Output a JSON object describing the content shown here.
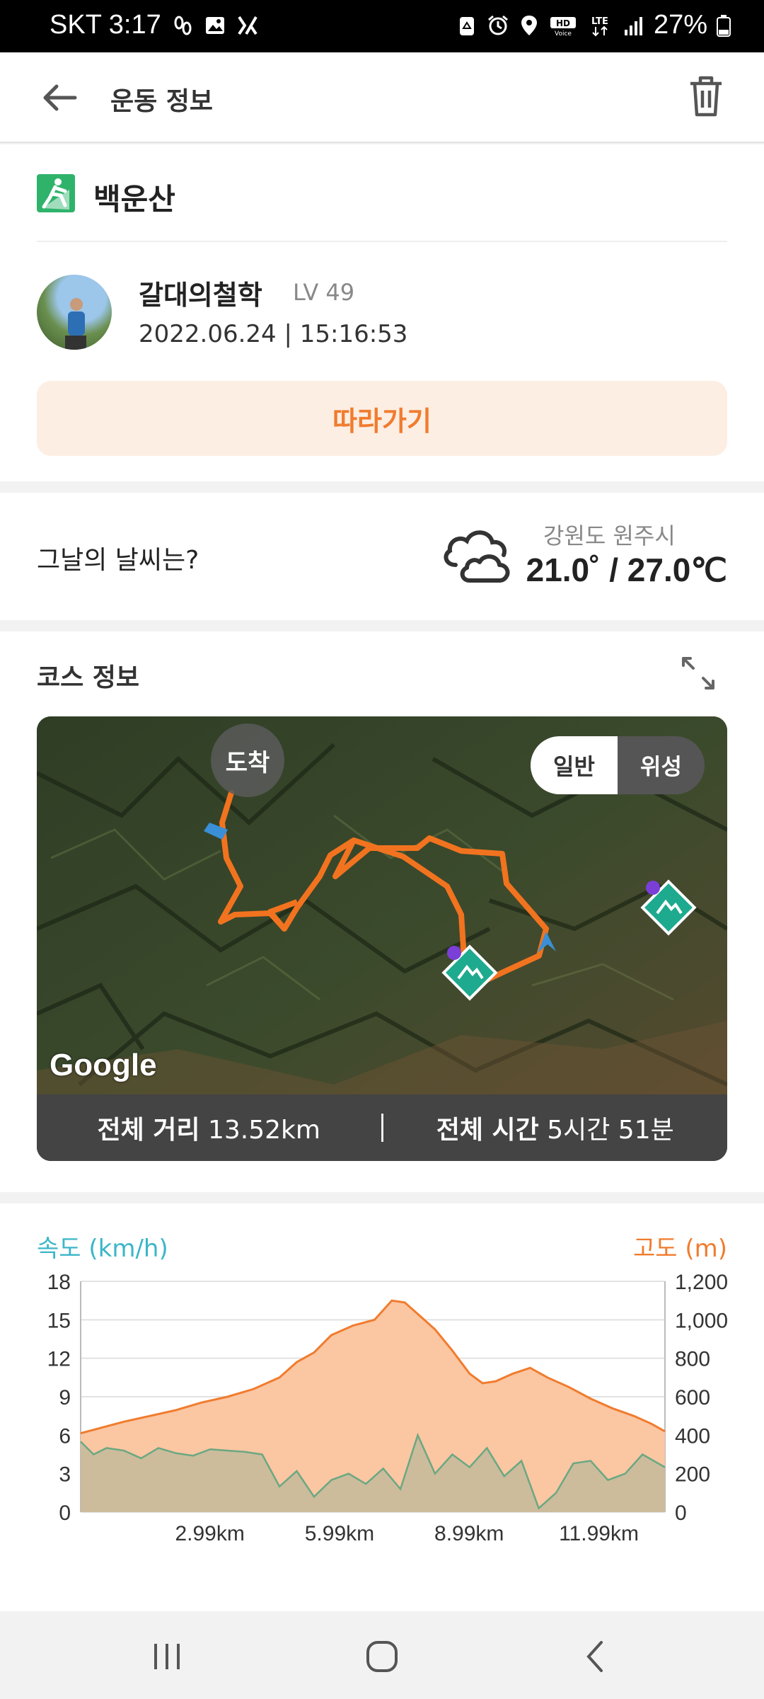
{
  "status_bar": {
    "carrier_time": "SKT 3:17",
    "battery_percent": "27%",
    "icons": [
      "steps-icon",
      "gallery-icon",
      "dev-icon",
      "recycle-icon",
      "alarm-icon",
      "location-icon",
      "hd-voice-icon",
      "lte-icon",
      "signal-icon",
      "battery-icon"
    ]
  },
  "header": {
    "title": "운동 정보"
  },
  "activity": {
    "name": "백운산",
    "user_name": "갈대의철학",
    "level": "LV 49",
    "datetime": "2022.06.24 | 15:16:53",
    "follow_button": "따라가기"
  },
  "weather": {
    "question": "그날의 날씨는?",
    "location": "강원도 원주시",
    "temperature": "21.0˚ / 27.0℃"
  },
  "course": {
    "title": "코스 정보",
    "toggle_general": "일반",
    "toggle_satellite": "위성",
    "arrival_label": "도착",
    "map_logo": "Google",
    "total_distance_label": "전체 거리",
    "total_distance_value": "13.52km",
    "total_time_label": "전체 시간",
    "total_time_value": "5시간 51분"
  },
  "chart_labels": {
    "speed_axis": "속도 (km/h)",
    "altitude_axis": "고도 (m)"
  },
  "colors": {
    "accent": "#f07c2e",
    "speed": "#3bb6c8",
    "altitude_fill": "#fbc6a2"
  },
  "chart_data": {
    "type": "area",
    "x_ticks": [
      "2.99km",
      "5.99km",
      "8.99km",
      "11.99km"
    ],
    "x_tick_values": [
      2.99,
      5.99,
      8.99,
      11.99
    ],
    "xlim": [
      0,
      13.52
    ],
    "y_left_ticks": [
      0,
      3,
      6,
      9,
      12,
      15,
      18
    ],
    "y_left_label": "속도 (km/h)",
    "ylim_left": [
      0,
      18
    ],
    "y_right_ticks": [
      "0",
      "200",
      "400",
      "600",
      "800",
      "1,000",
      "1,200"
    ],
    "y_right_values": [
      0,
      200,
      400,
      600,
      800,
      1000,
      1200
    ],
    "y_right_label": "고도 (m)",
    "ylim_right": [
      0,
      1200
    ],
    "grid": true,
    "series": [
      {
        "name": "고도 (m)",
        "x": [
          0,
          0.5,
          1.0,
          1.6,
          2.2,
          2.8,
          3.4,
          4.0,
          4.6,
          5.0,
          5.4,
          5.8,
          6.3,
          6.8,
          7.2,
          7.5,
          7.8,
          8.2,
          8.6,
          9.0,
          9.3,
          9.6,
          10.0,
          10.4,
          10.8,
          11.3,
          11.8,
          12.3,
          12.8,
          13.2,
          13.52
        ],
        "values": [
          410,
          440,
          470,
          500,
          530,
          570,
          600,
          640,
          700,
          780,
          830,
          920,
          970,
          1000,
          1100,
          1090,
          1030,
          950,
          840,
          720,
          670,
          680,
          720,
          750,
          700,
          650,
          590,
          540,
          500,
          460,
          420
        ]
      },
      {
        "name": "속도 (km/h)",
        "x": [
          0,
          0.3,
          0.6,
          1.0,
          1.4,
          1.8,
          2.2,
          2.6,
          3.0,
          3.4,
          3.8,
          4.2,
          4.6,
          5.0,
          5.4,
          5.8,
          6.2,
          6.6,
          7.0,
          7.4,
          7.8,
          8.2,
          8.6,
          9.0,
          9.4,
          9.8,
          10.2,
          10.6,
          11.0,
          11.4,
          11.8,
          12.2,
          12.6,
          13.0,
          13.52
        ],
        "values": [
          5.5,
          4.5,
          5.0,
          4.8,
          4.2,
          5.0,
          4.6,
          4.4,
          4.9,
          4.8,
          4.7,
          4.5,
          2.0,
          3.2,
          1.2,
          2.5,
          3.0,
          2.2,
          3.4,
          1.8,
          6.0,
          3.0,
          4.5,
          3.5,
          5.0,
          2.8,
          4.0,
          0.3,
          1.5,
          3.8,
          4.0,
          2.5,
          3.0,
          4.5,
          3.5
        ]
      }
    ]
  }
}
